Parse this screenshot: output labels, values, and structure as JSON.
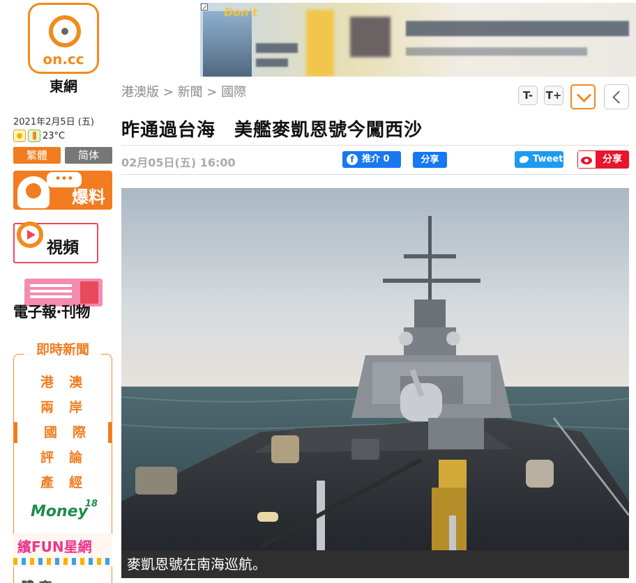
{
  "brand": {
    "logo_text": "on.cc",
    "name": "東網"
  },
  "sidebar": {
    "date": "2021年2月5日 (五)",
    "temperature": "23°C",
    "lang": {
      "traditional": "繁體",
      "simplified": "简体"
    },
    "promos": {
      "baoliao": "爆料",
      "baoliao_bubble": "•••",
      "video": "視頻",
      "epaper": "電子報·刊物"
    },
    "news": {
      "title": "即時新聞",
      "items": [
        {
          "label": "港澳",
          "active": false
        },
        {
          "label": "兩岸",
          "active": false
        },
        {
          "label": "國際",
          "active": true
        },
        {
          "label": "評論",
          "active": false
        },
        {
          "label": "產經",
          "active": false
        }
      ]
    },
    "money": {
      "num": "18",
      "text": "Money"
    },
    "fun": {
      "text": "繽FUN星網"
    },
    "bottom_partial": "體 育"
  },
  "banner": {
    "partial_text": "Don't"
  },
  "breadcrumb": {
    "items": [
      "港澳版",
      "新聞",
      "國際"
    ],
    "separator": ">"
  },
  "toolbar": {
    "font_smaller": "T-",
    "font_larger": "T+"
  },
  "article": {
    "headline": "昨通過台海　美艦麥凱恩號今闖西沙",
    "date": "02月05日(五) 16:00",
    "caption": "麥凱恩號在南海巡航。"
  },
  "share": {
    "fb_like": "推介 0",
    "fb_like_icon": "f",
    "fb_share": "分享",
    "tweet": "Tweet",
    "weibo": "分享"
  },
  "colors": {
    "brand": "#f28a1d",
    "facebook": "#1877f2",
    "twitter": "#1d9bf0",
    "weibo": "#e6162d"
  }
}
